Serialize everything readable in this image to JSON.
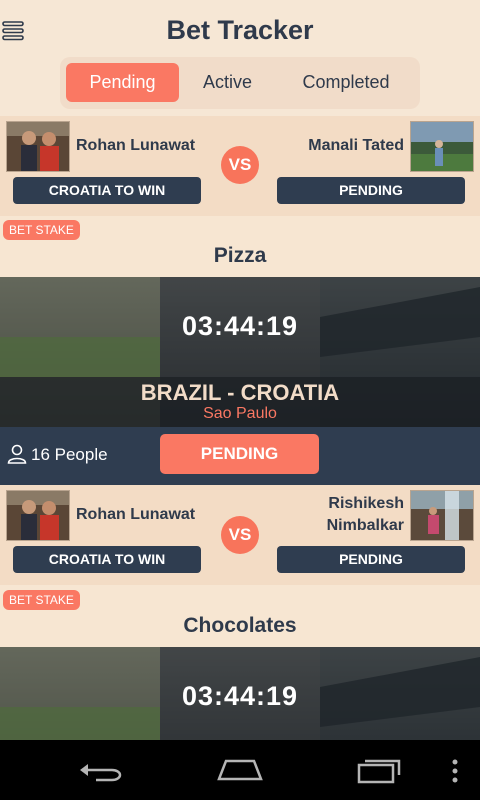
{
  "app": {
    "title": "Bet Tracker"
  },
  "tabs": [
    {
      "label": "Pending",
      "active": true
    },
    {
      "label": "Active",
      "active": false
    },
    {
      "label": "Completed",
      "active": false
    }
  ],
  "colors": {
    "accent": "#fa7863",
    "dark": "#2f3d50",
    "background": "#f7e6d2"
  },
  "cards": [
    {
      "left_player": "Rohan Lunawat",
      "right_player": "Manali Tated",
      "vs": "VS",
      "left_pick": "CROATIA TO WIN",
      "right_pick": "PENDING",
      "stake_label": "BET STAKE",
      "stake": "Pizza",
      "timer": "03:44:19",
      "teams": "BRAZIL - CROATIA",
      "venue": "Sao Paulo",
      "people": "16 People",
      "status_button": "PENDING"
    },
    {
      "left_player": "Rohan Lunawat",
      "right_player_line1": "Rishikesh",
      "right_player_line2": "Nimbalkar",
      "vs": "VS",
      "left_pick": "CROATIA TO WIN",
      "right_pick": "PENDING",
      "stake_label": "BET STAKE",
      "stake": "Chocolates",
      "timer": "03:44:19"
    }
  ],
  "icons": {
    "menu": "menu-icon",
    "people": "person-icon",
    "back": "back-icon",
    "home": "home-icon",
    "recents": "recents-icon",
    "overflow": "overflow-icon"
  }
}
